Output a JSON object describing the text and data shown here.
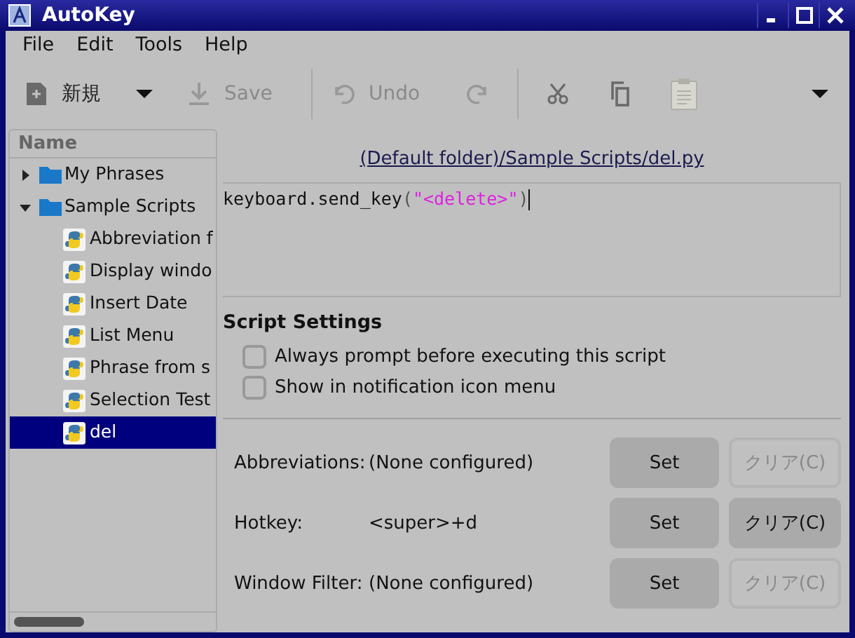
{
  "window": {
    "title": "AutoKey"
  },
  "menu": [
    "File",
    "Edit",
    "Tools",
    "Help"
  ],
  "toolbar": [
    {
      "kind": "new",
      "label": "新規",
      "disabled": false
    },
    {
      "kind": "dropdown",
      "disabled": false
    },
    {
      "kind": "save",
      "label": "Save",
      "disabled": true
    },
    {
      "kind": "separator"
    },
    {
      "kind": "undo",
      "label": "Undo",
      "disabled": true
    },
    {
      "kind": "redo",
      "disabled": true
    },
    {
      "kind": "separator"
    },
    {
      "kind": "cut",
      "disabled": false
    },
    {
      "kind": "copy",
      "disabled": false
    },
    {
      "kind": "paste",
      "disabled": true
    },
    {
      "kind": "overflow",
      "disabled": false
    }
  ],
  "tree": {
    "header": "Name",
    "items": [
      {
        "kind": "folder",
        "label": "My Phrases",
        "expanded": false,
        "selected": false
      },
      {
        "kind": "folder",
        "label": "Sample Scripts",
        "expanded": true,
        "selected": false,
        "children": [
          {
            "kind": "script",
            "label": "Abbreviation f",
            "selected": false
          },
          {
            "kind": "script",
            "label": "Display windo",
            "selected": false
          },
          {
            "kind": "script",
            "label": "Insert Date",
            "selected": false
          },
          {
            "kind": "script",
            "label": "List Menu",
            "selected": false
          },
          {
            "kind": "script",
            "label": "Phrase from s",
            "selected": false
          },
          {
            "kind": "script",
            "label": "Selection Test",
            "selected": false
          },
          {
            "kind": "script",
            "label": "del",
            "selected": true
          }
        ]
      }
    ]
  },
  "path_link": "(Default folder)/Sample Scripts/del.py",
  "code": [
    {
      "kind": "plain",
      "text": "keyboard.send_key"
    },
    {
      "kind": "paren",
      "text": "("
    },
    {
      "kind": "string",
      "text": "\"<delete>\""
    },
    {
      "kind": "paren",
      "text": ")"
    }
  ],
  "script_settings": {
    "title": "Script Settings",
    "options": [
      {
        "label": "Always prompt before executing this script",
        "checked": false
      },
      {
        "label": "Show in notification icon menu",
        "checked": false
      }
    ]
  },
  "bindings": [
    {
      "label": "Abbreviations:",
      "value": "(None configured)",
      "set": "Set",
      "clear": "クリア(C)",
      "clear_disabled": true
    },
    {
      "label": "Hotkey:",
      "value": "<super>+d",
      "set": "Set",
      "clear": "クリア(C)",
      "clear_disabled": false
    },
    {
      "label": "Window Filter:",
      "value": "(None configured)",
      "set": "Set",
      "clear": "クリア(C)",
      "clear_disabled": true
    }
  ]
}
